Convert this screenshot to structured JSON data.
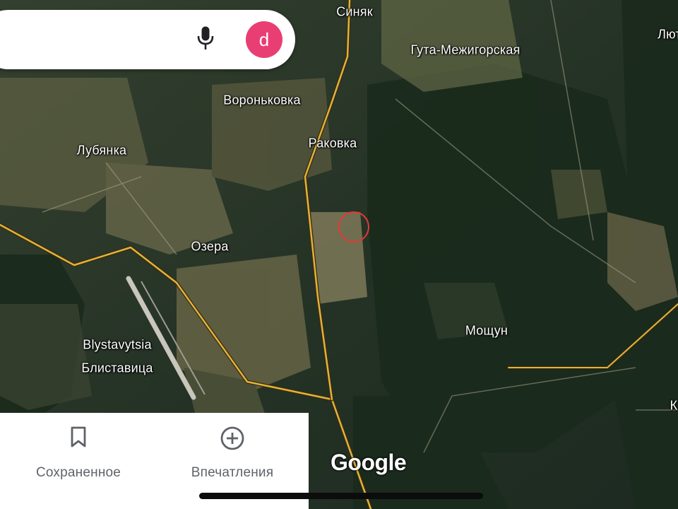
{
  "map": {
    "view": "satellite",
    "place_labels": [
      {
        "id": "syniak",
        "text": "Синяк"
      },
      {
        "id": "huta",
        "text": "Гута-Межигорская"
      },
      {
        "id": "lyut",
        "text": "Лют"
      },
      {
        "id": "voronkovka",
        "text": "Вороньковка"
      },
      {
        "id": "rakovka",
        "text": "Раковка"
      },
      {
        "id": "lubyanka",
        "text": "Лубянка"
      },
      {
        "id": "ozera",
        "text": "Озера"
      },
      {
        "id": "blystavytsia_lat",
        "text": "Blystavytsia"
      },
      {
        "id": "blystavytsia_cyr",
        "text": "Блиставица"
      },
      {
        "id": "moshchun",
        "text": "Мощун"
      },
      {
        "id": "k_partial",
        "text": "К"
      }
    ],
    "marker": {
      "type": "circle",
      "color": "#e53935"
    },
    "road_color": "#e0b33a",
    "watermark": "Google"
  },
  "search": {
    "mic_icon": "microphone-icon",
    "avatar_letter": "d",
    "avatar_color": "#e83e74"
  },
  "bottom_nav": {
    "items": [
      {
        "label": "Сохраненное",
        "icon": "bookmark-icon"
      },
      {
        "label": "Впечатления",
        "icon": "add-circle-icon"
      }
    ]
  }
}
